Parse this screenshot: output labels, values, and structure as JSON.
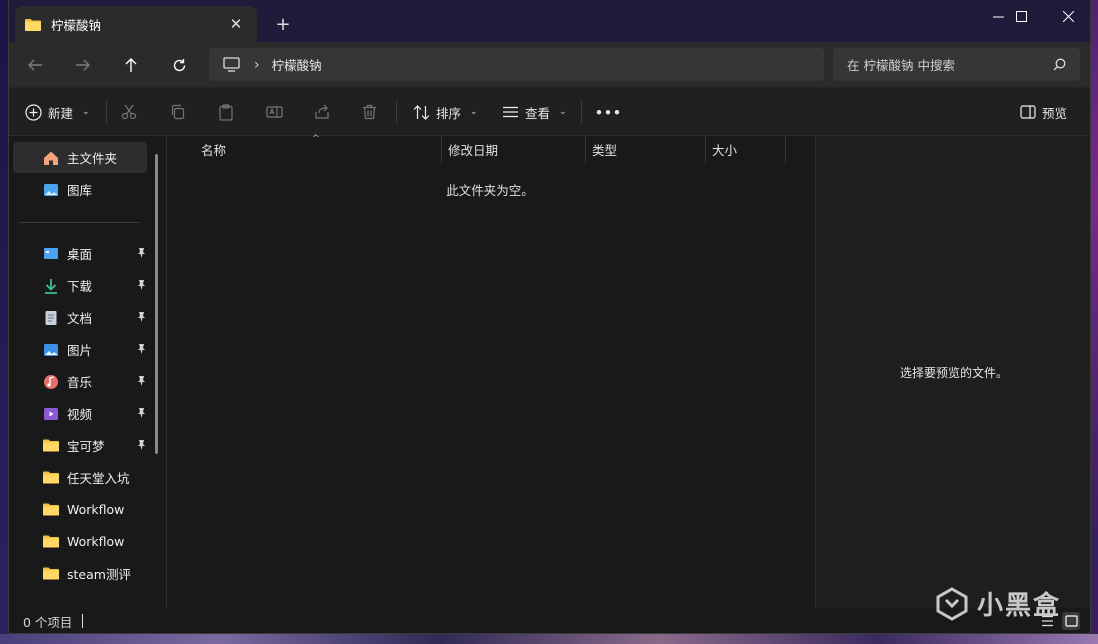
{
  "window": {
    "tab_title": "柠檬酸钠",
    "new_tab": "+",
    "close_tab": "✕"
  },
  "nav": {
    "breadcrumb_current": "柠檬酸钠",
    "search_placeholder": "在 柠檬酸钠 中搜索"
  },
  "toolbar": {
    "new_label": "新建",
    "sort_label": "排序",
    "view_label": "查看",
    "more_label": "•••",
    "preview_label": "预览"
  },
  "sidebar": {
    "top_items": [
      {
        "label": "主文件夹",
        "icon": "home-icon",
        "selected": true
      },
      {
        "label": "图库",
        "icon": "gallery-icon",
        "selected": false
      }
    ],
    "pinned_items": [
      {
        "label": "桌面",
        "icon": "desktop-icon",
        "pinned": true
      },
      {
        "label": "下载",
        "icon": "download-icon",
        "pinned": true
      },
      {
        "label": "文档",
        "icon": "document-icon",
        "pinned": true
      },
      {
        "label": "图片",
        "icon": "pictures-icon",
        "pinned": true
      },
      {
        "label": "音乐",
        "icon": "music-icon",
        "pinned": true
      },
      {
        "label": "视频",
        "icon": "video-icon",
        "pinned": true
      },
      {
        "label": "宝可梦",
        "icon": "folder-icon",
        "pinned": true
      },
      {
        "label": "任天堂入坑",
        "icon": "folder-icon",
        "pinned": false
      },
      {
        "label": "Workflow",
        "icon": "folder-icon",
        "pinned": false
      },
      {
        "label": "Workflow",
        "icon": "folder-icon",
        "pinned": false
      },
      {
        "label": "steam测评",
        "icon": "folder-icon",
        "pinned": false
      }
    ]
  },
  "content": {
    "columns": [
      "名称",
      "修改日期",
      "类型",
      "大小"
    ],
    "empty_message": "此文件夹为空。"
  },
  "preview": {
    "message": "选择要预览的文件。"
  },
  "status": {
    "item_count": "0 个项目"
  },
  "watermark": {
    "text": "小黑盒"
  },
  "colors": {
    "folder": "#f6c343",
    "accent_blue": "#4aa3f0",
    "download_green": "#3fbf8f"
  }
}
